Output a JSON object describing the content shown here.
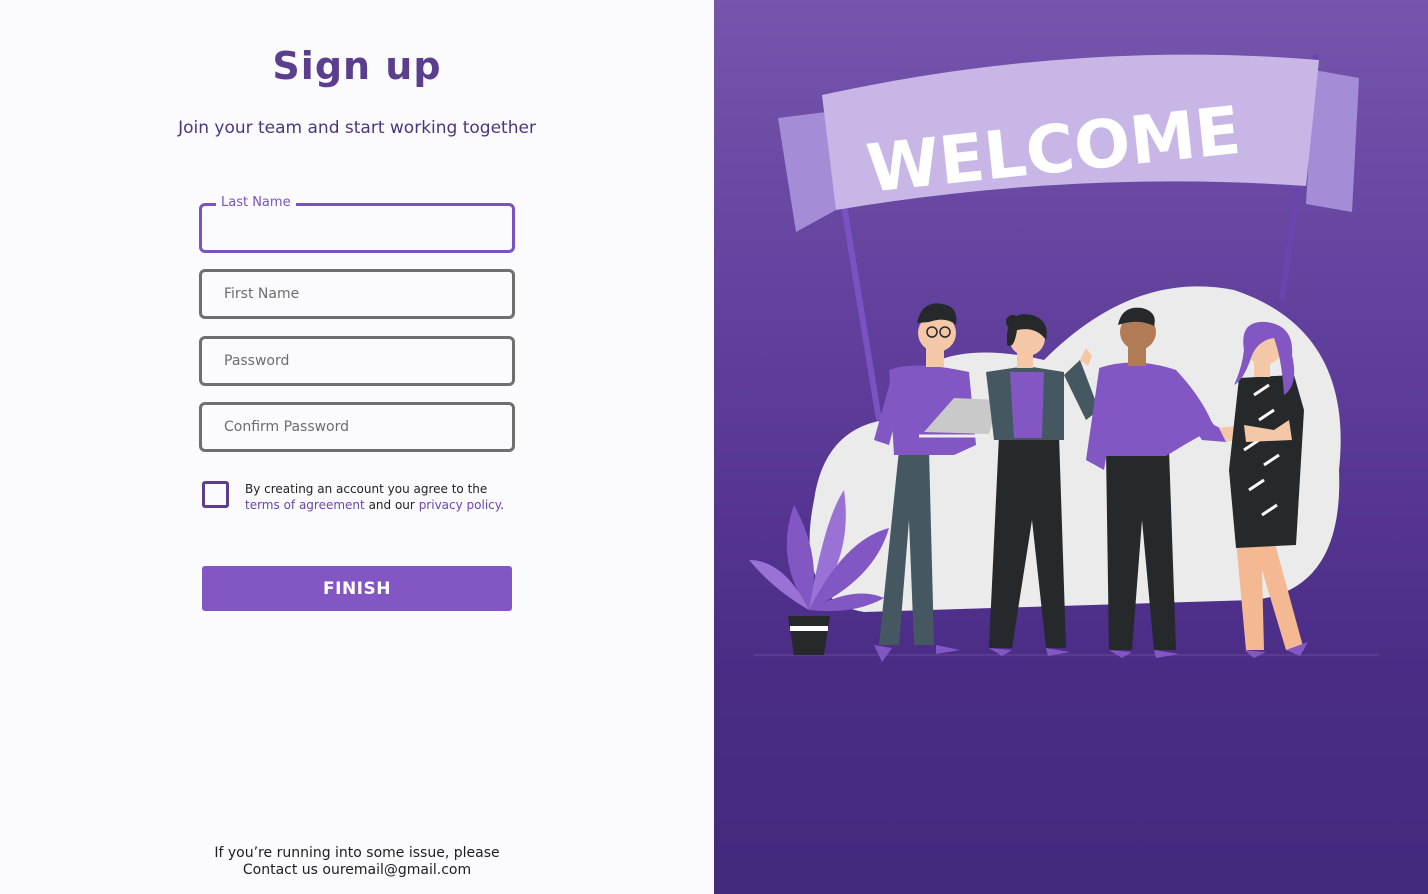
{
  "form": {
    "title": "Sign up",
    "subtitle": "Join your team and start working together",
    "last_name_label": "Last Name",
    "first_name_placeholder": "First Name",
    "password_placeholder": "Password",
    "confirm_password_placeholder": "Confirm Password",
    "agreement_prefix": "By creating an account you agree to the",
    "terms_link": "terms of agreement",
    "agreement_middle": "and our",
    "privacy_link": "privacy policy",
    "agreement_suffix": ".",
    "finish_label": "FINISH"
  },
  "footer": {
    "line1": "If you’re running into some issue, please",
    "line2": "Contact us ouremail@gmail.com"
  },
  "illustration": {
    "banner_text": "WELCOME"
  },
  "colors": {
    "accent": "#8257c3",
    "title": "#5b3e8e",
    "panel_top": "#7655ad",
    "panel_bottom": "#432a7c"
  }
}
